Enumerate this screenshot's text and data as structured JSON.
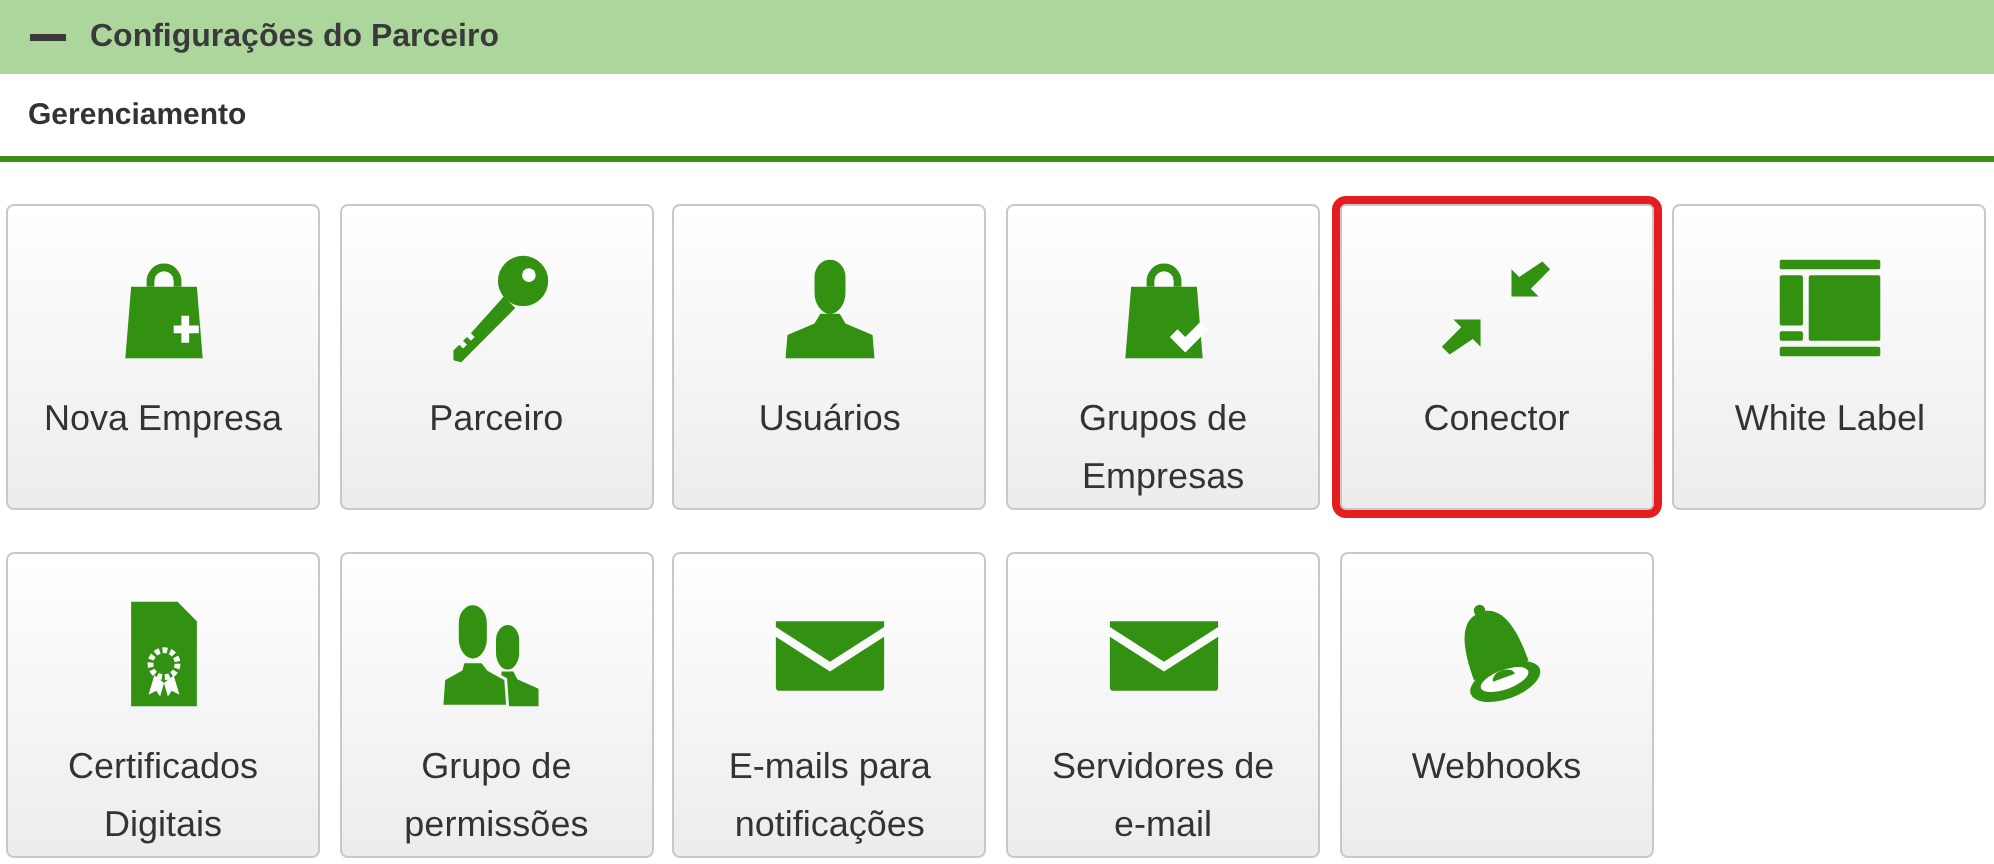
{
  "panel": {
    "title": "Configurações do Parceiro",
    "expanded": true
  },
  "section": {
    "title": "Gerenciamento"
  },
  "tiles": [
    {
      "label": "Nova Empresa",
      "kind": "bagplus",
      "highlighted": false
    },
    {
      "label": "Parceiro",
      "kind": "key",
      "highlighted": false
    },
    {
      "label": "Usuários",
      "kind": "user",
      "highlighted": false
    },
    {
      "label": "Grupos de Empresas",
      "kind": "bagcheck",
      "highlighted": false
    },
    {
      "label": "Conector",
      "kind": "compress",
      "highlighted": true
    },
    {
      "label": "White Label",
      "kind": "layout",
      "highlighted": false
    },
    {
      "label": "Certificados Digitais",
      "kind": "certificate",
      "highlighted": false
    },
    {
      "label": "Grupo de permissões",
      "kind": "users",
      "highlighted": false
    },
    {
      "label": "E-mails para notificações",
      "kind": "envelope",
      "highlighted": false
    },
    {
      "label": "Servidores de e-mail",
      "kind": "envelope",
      "highlighted": false
    },
    {
      "label": "Webhooks",
      "kind": "bell",
      "highlighted": false
    }
  ]
}
